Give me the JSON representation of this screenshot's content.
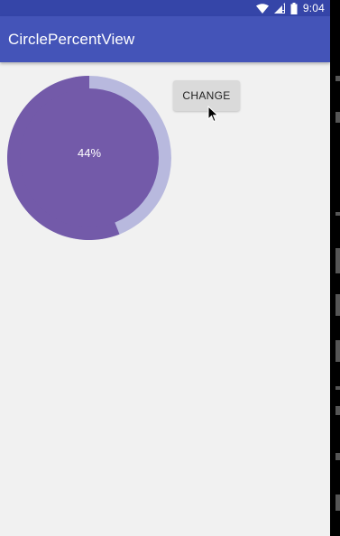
{
  "status_bar": {
    "time": "9:04",
    "icons": [
      "wifi-icon",
      "cell-signal-icon",
      "battery-icon"
    ]
  },
  "app_bar": {
    "title": "CirclePercentView"
  },
  "circle_percent_view": {
    "label": "44%",
    "progress": 0.44,
    "fill_color": "#735aa9",
    "ring_color": "#b8b9de"
  },
  "change_button": {
    "label": "CHANGE"
  },
  "colors": {
    "status_bar": "#3545a8",
    "app_bar": "#4454b8",
    "background": "#f1f1f1"
  }
}
